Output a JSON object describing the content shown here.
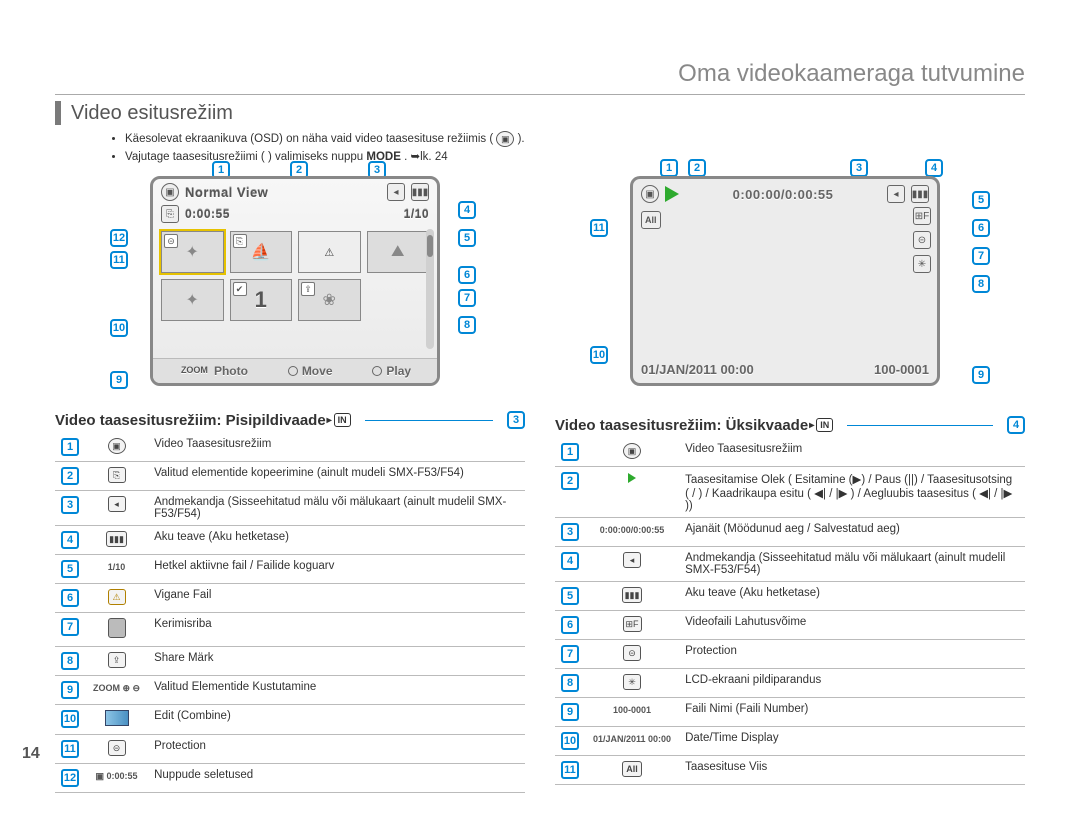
{
  "chapter": "Oma videokaameraga tutvumine",
  "page_number": "14",
  "section_title": "Video esitusrežiim",
  "bullets": [
    "Käesolevat ekraanikuva (OSD) on näha vaid video taasesituse režiimis (",
    "Vajutage taasesitusrežiimi (   ) valimiseks nuppu "
  ],
  "bullet1_tail": ").",
  "mode_word": "MODE",
  "bullet2_tail": ". ➥lk. 24",
  "screen_thumb": {
    "title": "Normal View",
    "duration": "0:00:55",
    "counter": "1/10",
    "photo": "Photo",
    "move": "Move",
    "play": "Play",
    "zoom": "ZOOM",
    "big_one": "1"
  },
  "screen_single": {
    "time": "0:00:00/0:00:55",
    "all": "All",
    "date": "01/JAN/2011 00:00",
    "file": "100-0001"
  },
  "subtitle_left": "Video taasesitusrežiim: Pisipildivaade",
  "subtitle_right": "Video taasesitusrežiim: Üksikvaade",
  "in_chip": "IN",
  "subtitle_left_num": "3",
  "subtitle_right_num": "4",
  "left_callouts": {
    "top": [
      "1",
      "2",
      "3"
    ],
    "r": [
      "4",
      "5",
      "6",
      "7",
      "8"
    ],
    "l": [
      "12",
      "11",
      "10",
      "9"
    ]
  },
  "right_callouts": {
    "top": [
      "1",
      "2",
      "3",
      "4"
    ],
    "r": [
      "5",
      "6",
      "7",
      "8",
      "9"
    ],
    "l": [
      "11",
      "10"
    ]
  },
  "legend_left": [
    {
      "n": "1",
      "ic": "play-mode",
      "t": "Video Taasesitusrežiim"
    },
    {
      "n": "2",
      "ic": "copy",
      "t": "Valitud elementide kopeerimine (ainult mudeli SMX-F53/F54)"
    },
    {
      "n": "3",
      "ic": "media",
      "t": "Andmekandja (Sisseehitatud mälu või mälukaart (ainult mudelil SMX-F53/F54)"
    },
    {
      "n": "4",
      "ic": "batt",
      "t": "Aku teave (Aku hetketase)"
    },
    {
      "n": "5",
      "ic": "1/10",
      "t": "Hetkel aktiivne fail / Failide koguarv"
    },
    {
      "n": "6",
      "ic": "warn",
      "t": "Vigane Fail"
    },
    {
      "n": "7",
      "ic": "scroll",
      "t": "Kerimisriba"
    },
    {
      "n": "8",
      "ic": "share",
      "t": "Share Märk"
    },
    {
      "n": "9",
      "ic": "zoomdel",
      "t": "Valitud Elementide Kustutamine"
    },
    {
      "n": "10",
      "ic": "edit",
      "t": "Edit (Combine)"
    },
    {
      "n": "11",
      "ic": "lock",
      "t": "Protection"
    },
    {
      "n": "12",
      "ic": "dur",
      "t": "Nuppude seletused"
    }
  ],
  "legend_right": [
    {
      "n": "1",
      "ic": "play-mode",
      "t": "Video Taasesitusrežiim"
    },
    {
      "n": "2",
      "ic": "playstate",
      "t": "Taasesitamise Olek ( Esitamine (▶) / Paus (||) / Taasesitusotsing (  /  ) / Kaadrikaupa esitu ( ◀| / |▶ ) / Aegluubis taasesitus ( ◀| / |▶ ))"
    },
    {
      "n": "3",
      "ic": "0:00:00/0:00:55",
      "t": "Ajanäit (Möödunud aeg / Salvestatud aeg)"
    },
    {
      "n": "4",
      "ic": "media",
      "t": "Andmekandja (Sisseehitatud mälu või mälukaart (ainult mudelil SMX-F53/F54)"
    },
    {
      "n": "5",
      "ic": "batt",
      "t": "Aku teave (Aku hetketase)"
    },
    {
      "n": "6",
      "ic": "res",
      "t": "Videofaili Lahutusvõime"
    },
    {
      "n": "7",
      "ic": "lock",
      "t": "Protection"
    },
    {
      "n": "8",
      "ic": "lcd",
      "t": "LCD-ekraani pildiparandus"
    },
    {
      "n": "9",
      "ic": "100-0001",
      "t": "Faili Nimi (Faili Number)"
    },
    {
      "n": "10",
      "ic": "01/JAN/2011 00:00",
      "t": "Date/Time Display"
    },
    {
      "n": "11",
      "ic": "all",
      "t": "Taasesituse Viis"
    }
  ]
}
